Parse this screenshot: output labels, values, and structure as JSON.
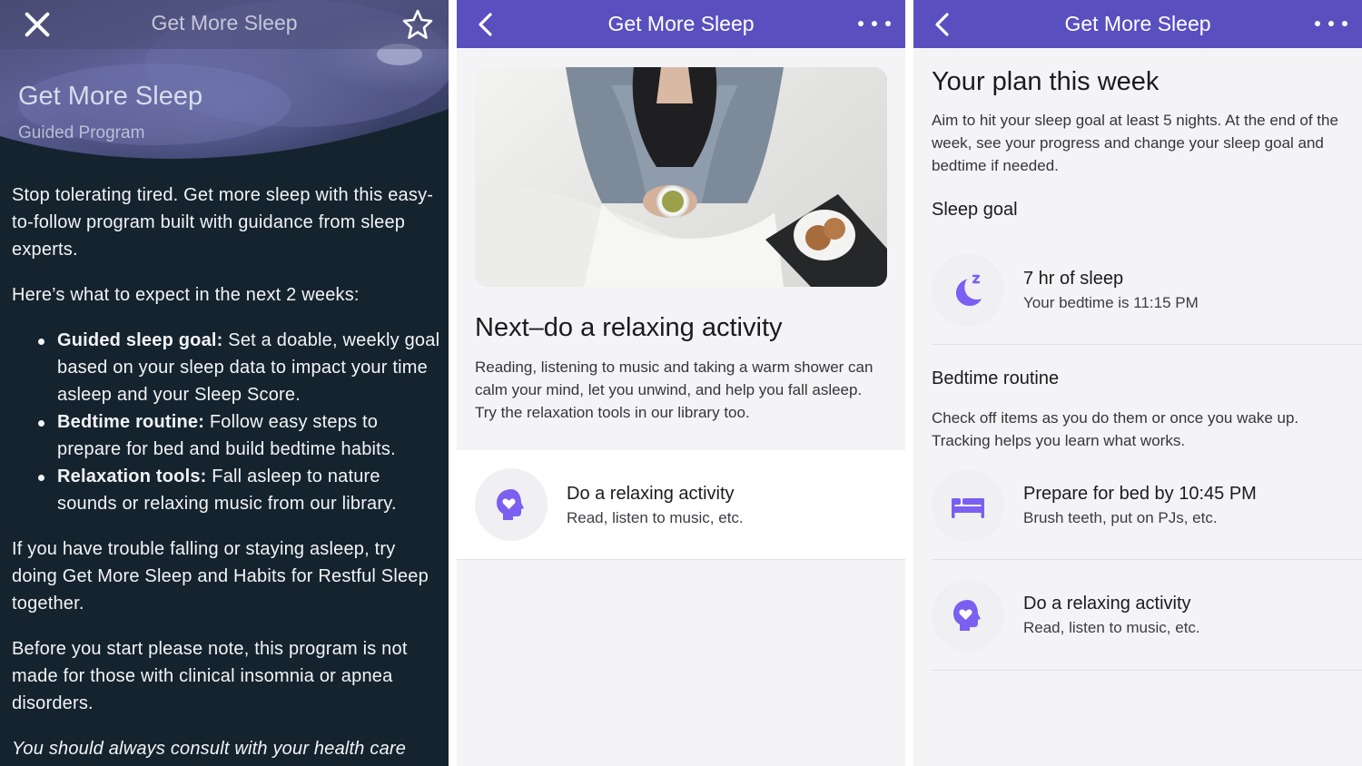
{
  "colors": {
    "accent": "#5a4fbf",
    "icon": "#7b5ff1",
    "dark_bg": "#15232f"
  },
  "panel1": {
    "header_title": "Get More Sleep",
    "hero_title": "Get More Sleep",
    "hero_subtitle": "Guided Program",
    "intro": "Stop tolerating tired. Get more sleep with this easy-to-follow program built with guidance from sleep experts.",
    "expect": "Here’s what to expect in the next 2 weeks:",
    "bullets": [
      {
        "label": "Guided sleep goal:",
        "text": " Set a doable, weekly goal based on your sleep data to impact your time asleep and your Sleep Score."
      },
      {
        "label": "Bedtime routine:",
        "text": " Follow easy steps to prepare for bed and build bedtime habits."
      },
      {
        "label": "Relaxation tools:",
        "text": " Fall asleep to nature sounds or relaxing music from our library."
      }
    ],
    "trouble": "If you have trouble falling or staying asleep, try doing Get More Sleep and Habits for Restful Sleep together.",
    "note": "Before you start please note, this program is not made for those with clinical insomnia or apnea disorders.",
    "consult": "You should always consult with your health care"
  },
  "panel2": {
    "header_title": "Get More Sleep",
    "heading": "Next–do a relaxing activity",
    "text": "Reading, listening to music and taking a warm shower can calm your mind, let you unwind, and help you fall asleep. Try the relaxation tools in our library too.",
    "item": {
      "title": "Do a relaxing activity",
      "subtitle": "Read, listen to music, etc."
    }
  },
  "panel3": {
    "header_title": "Get More Sleep",
    "heading": "Your plan this week",
    "text": "Aim to hit your sleep goal at least 5 nights. At the end of the week, see your progress and change your sleep goal and bedtime if needed.",
    "sleep_goal_label": "Sleep goal",
    "goal": {
      "title": "7 hr of sleep",
      "subtitle": "Your bedtime is 11:15 PM"
    },
    "routine_label": "Bedtime routine",
    "routine_text": "Check off items as you do them or once you wake up. Tracking helps you learn what works.",
    "items": [
      {
        "title": "Prepare for bed by 10:45 PM",
        "subtitle": "Brush teeth, put on PJs, etc."
      },
      {
        "title": "Do a relaxing activity",
        "subtitle": "Read, listen to music, etc."
      }
    ]
  }
}
